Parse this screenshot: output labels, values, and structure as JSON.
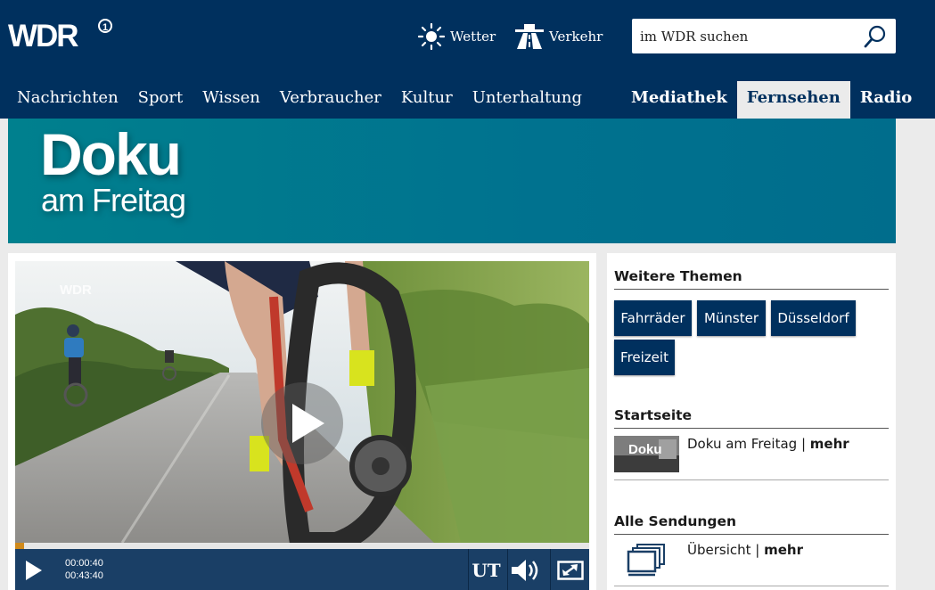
{
  "header": {
    "logo_text": "WDR",
    "services": [
      {
        "label": "Wetter",
        "icon": "sun-icon"
      },
      {
        "label": "Verkehr",
        "icon": "highway-icon"
      }
    ],
    "search": {
      "placeholder": "im WDR suchen",
      "icon": "search-icon"
    },
    "nav": [
      "Nachrichten",
      "Sport",
      "Wissen",
      "Verbraucher",
      "Kultur",
      "Unterhaltung"
    ],
    "nav_right": [
      {
        "label": "Mediathek",
        "active": false
      },
      {
        "label": "Fernsehen",
        "active": true
      },
      {
        "label": "Radio",
        "active": false
      }
    ]
  },
  "banner": {
    "title": "Doku",
    "subtitle": "am Freitag"
  },
  "player": {
    "watermark": "WDR",
    "progress": 0.015,
    "time_current": "00:00:40",
    "time_total": "00:43:40",
    "subtitle_button": "UT",
    "icons": [
      "play-icon",
      "volume-icon",
      "fullscreen-icon"
    ]
  },
  "sidebar": {
    "weitere_themen": {
      "heading": "Weitere Themen",
      "tags": [
        "Fahrräder",
        "Münster",
        "Düsseldorf",
        "Freizeit"
      ]
    },
    "startseite": {
      "heading": "Startseite",
      "item_text": "Doku am Freitag",
      "separator": " | ",
      "more": "mehr",
      "thumb_text": "Doku"
    },
    "alle_sendungen": {
      "heading": "Alle Sendungen",
      "item_text": "Übersicht",
      "separator": " | ",
      "more": "mehr"
    }
  },
  "colors": {
    "brand": "#00305e",
    "banner": "#00808e",
    "progress": "#d08a1c"
  }
}
